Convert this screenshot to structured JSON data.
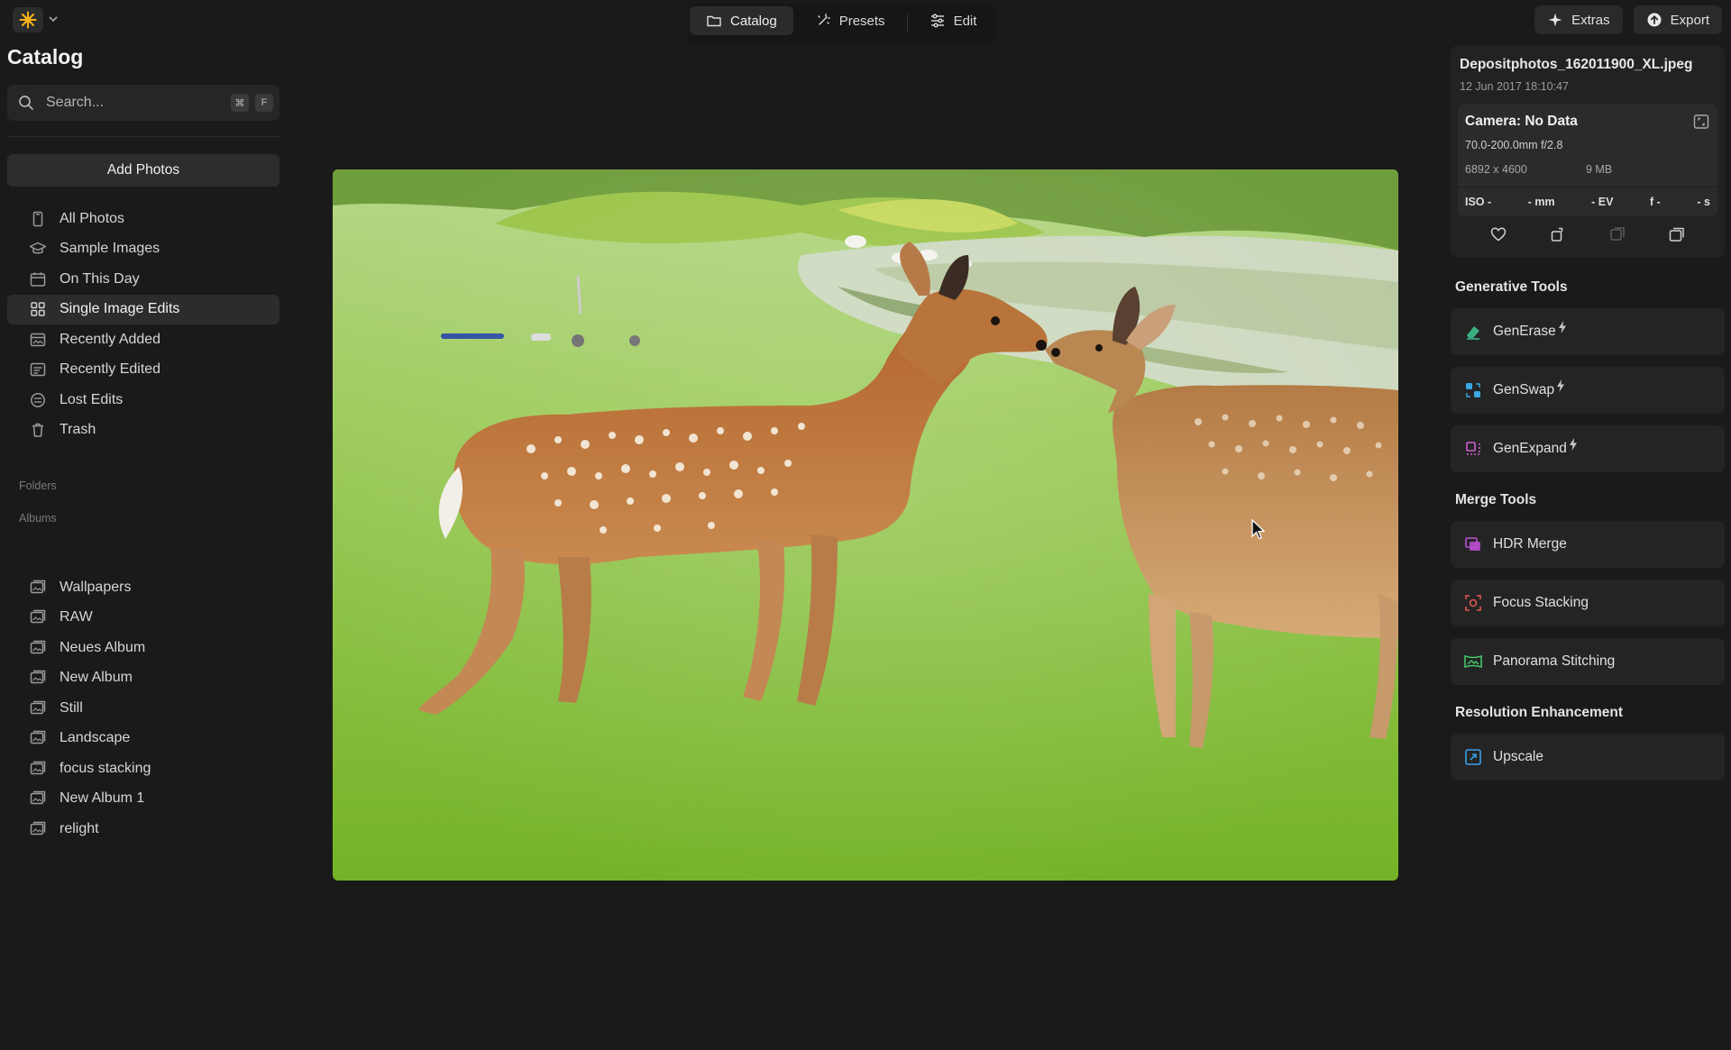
{
  "app": {
    "logo_icon": "sun-icon",
    "accent": "#f5b21a"
  },
  "top_tabs": [
    {
      "label": "Catalog",
      "icon": "folder-icon",
      "active": true
    },
    {
      "label": "Presets",
      "icon": "sparkle-icon",
      "active": false
    },
    {
      "label": "Edit",
      "icon": "sliders-icon",
      "active": false
    }
  ],
  "top_right": {
    "extras_label": "Extras",
    "export_label": "Export"
  },
  "sidebar": {
    "title": "Catalog",
    "search": {
      "placeholder": "Search...",
      "shortcut_mod": "⌘",
      "shortcut_key": "F"
    },
    "add_photos_label": "Add Photos",
    "library": [
      {
        "label": "All Photos",
        "icon": "phone-icon"
      },
      {
        "label": "Sample Images",
        "icon": "graduation-cap-icon"
      },
      {
        "label": "On This Day",
        "icon": "calendar-icon"
      },
      {
        "label": "Single Image Edits",
        "icon": "grid-icon",
        "active": true
      },
      {
        "label": "Recently Added",
        "icon": "image-plus-icon"
      },
      {
        "label": "Recently Edited",
        "icon": "edit-doc-icon"
      },
      {
        "label": "Lost Edits",
        "icon": "lost-icon"
      },
      {
        "label": "Trash",
        "icon": "trash-icon"
      }
    ],
    "folders_label": "Folders",
    "albums_label": "Albums",
    "albums": [
      {
        "label": "Wallpapers"
      },
      {
        "label": "RAW"
      },
      {
        "label": "Neues Album"
      },
      {
        "label": "New Album"
      },
      {
        "label": "Still"
      },
      {
        "label": "Landscape"
      },
      {
        "label": "focus stacking"
      },
      {
        "label": "New Album 1"
      },
      {
        "label": "relight"
      }
    ]
  },
  "info": {
    "file_name": "Depositphotos_162011900_XL.jpeg",
    "date": "12 Jun 2017 18:10:47",
    "camera": "Camera: No Data",
    "lens": "70.0-200.0mm f/2.8",
    "dimensions": "6892 x 4600",
    "size": "9 MB",
    "stats": [
      "ISO -",
      "- mm",
      "- EV",
      "f -",
      "- s"
    ]
  },
  "generative_tools": {
    "heading": "Generative Tools",
    "items": [
      {
        "label": "GenErase",
        "color": "#3fbf8c"
      },
      {
        "label": "GenSwap",
        "color": "#3aa7e0"
      },
      {
        "label": "GenExpand",
        "color": "#d05bd0"
      }
    ]
  },
  "merge_tools": {
    "heading": "Merge Tools",
    "items": [
      {
        "label": "HDR Merge",
        "color": "#c04fd6"
      },
      {
        "label": "Focus Stacking",
        "color": "#e0564f"
      },
      {
        "label": "Panorama Stitching",
        "color": "#45c46a"
      }
    ]
  },
  "resolution": {
    "heading": "Resolution Enhancement",
    "items": [
      {
        "label": "Upscale",
        "color": "#3a9ee6"
      }
    ]
  }
}
